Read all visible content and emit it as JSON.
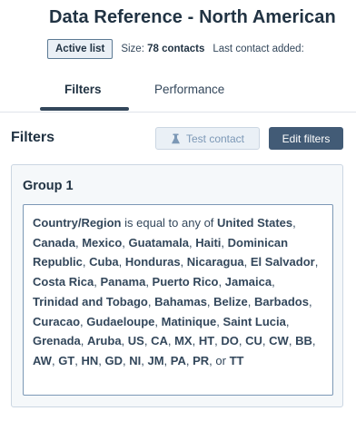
{
  "header": {
    "title": "Data Reference - North American",
    "badge": "Active list",
    "size_label": "Size:",
    "size_value": "78 contacts",
    "last_contact_label": "Last contact added:"
  },
  "tabs": [
    {
      "label": "Filters",
      "active": true
    },
    {
      "label": "Performance",
      "active": false
    }
  ],
  "filters": {
    "heading": "Filters",
    "test_contact_label": "Test contact",
    "edit_filters_label": "Edit filters"
  },
  "group": {
    "title": "Group 1",
    "property": "Country/Region",
    "operator": "is equal to any of",
    "values": [
      "United States",
      "Canada",
      "Mexico",
      "Guatamala",
      "Haiti",
      "Dominican Republic",
      "Cuba",
      "Honduras",
      "Nicaragua",
      "El Salvador",
      "Costa Rica",
      "Panama",
      "Puerto Rico",
      "Jamaica",
      "Trinidad and Tobago",
      "Bahamas",
      "Belize",
      "Barbados",
      "Curacao",
      "Gudaeloupe",
      "Matinique",
      "Saint Lucia",
      "Grenada",
      "Aruba",
      "US",
      "CA",
      "MX",
      "HT",
      "DO",
      "CU",
      "CW",
      "BB",
      "AW",
      "GT",
      "HN",
      "GD",
      "NI",
      "JM",
      "PA",
      "PR",
      "TT"
    ],
    "separator": ", ",
    "last_connector": ", or "
  },
  "colors": {
    "heading": "#213343",
    "text": "#33475b",
    "primary_button": "#425b76",
    "secondary_button_bg": "#eaf0f6",
    "card_bg": "#f5f8fa",
    "border": "#cbd6e2"
  },
  "icons": {
    "test_contact": "flask-icon"
  }
}
